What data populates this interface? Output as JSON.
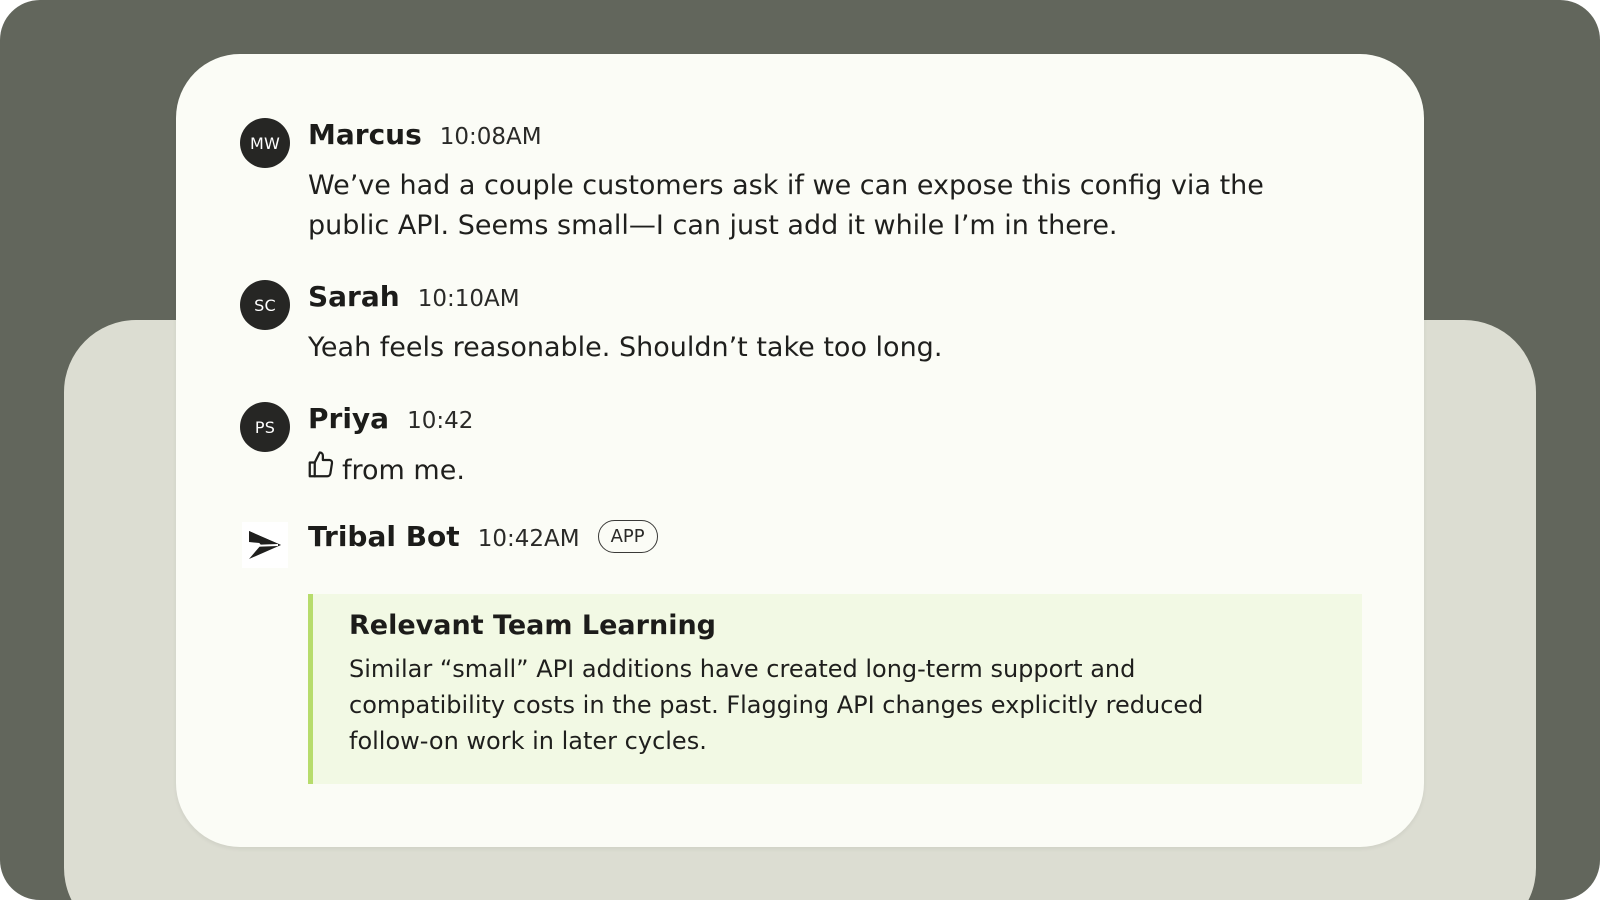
{
  "messages": [
    {
      "initials": "MW",
      "author": "Marcus",
      "time": "10:08AM",
      "text_line1": "We’ve had a couple customers ask if we can expose this config via the",
      "text_line2": "public API. Seems small—I can just add it while I’m in there."
    },
    {
      "initials": "SC",
      "author": "Sarah",
      "time": "10:10AM",
      "text": "Yeah feels reasonable. Shouldn’t take too long."
    },
    {
      "initials": "PS",
      "author": "Priya",
      "time": "10:42",
      "reaction_icon": "thumbs-up-icon",
      "text": "from me."
    }
  ],
  "bot": {
    "logo_icon": "tribal-bot-logo-icon",
    "author": "Tribal Bot",
    "time": "10:42AM",
    "badge": "APP",
    "learning": {
      "title": "Relevant Team Learning",
      "line1": "Similar “small” API additions have created long-term support and",
      "line2": "compatibility costs in the past. Flagging API changes explicitly reduced",
      "line3": "follow-on work in later cycles.",
      "accent_color": "#b7dc6c",
      "background_color": "#f2f9e4"
    }
  },
  "colors": {
    "frame": "#62665c",
    "back_panel": "#dcddd2",
    "card": "#fbfcf6",
    "avatar": "#262624"
  }
}
